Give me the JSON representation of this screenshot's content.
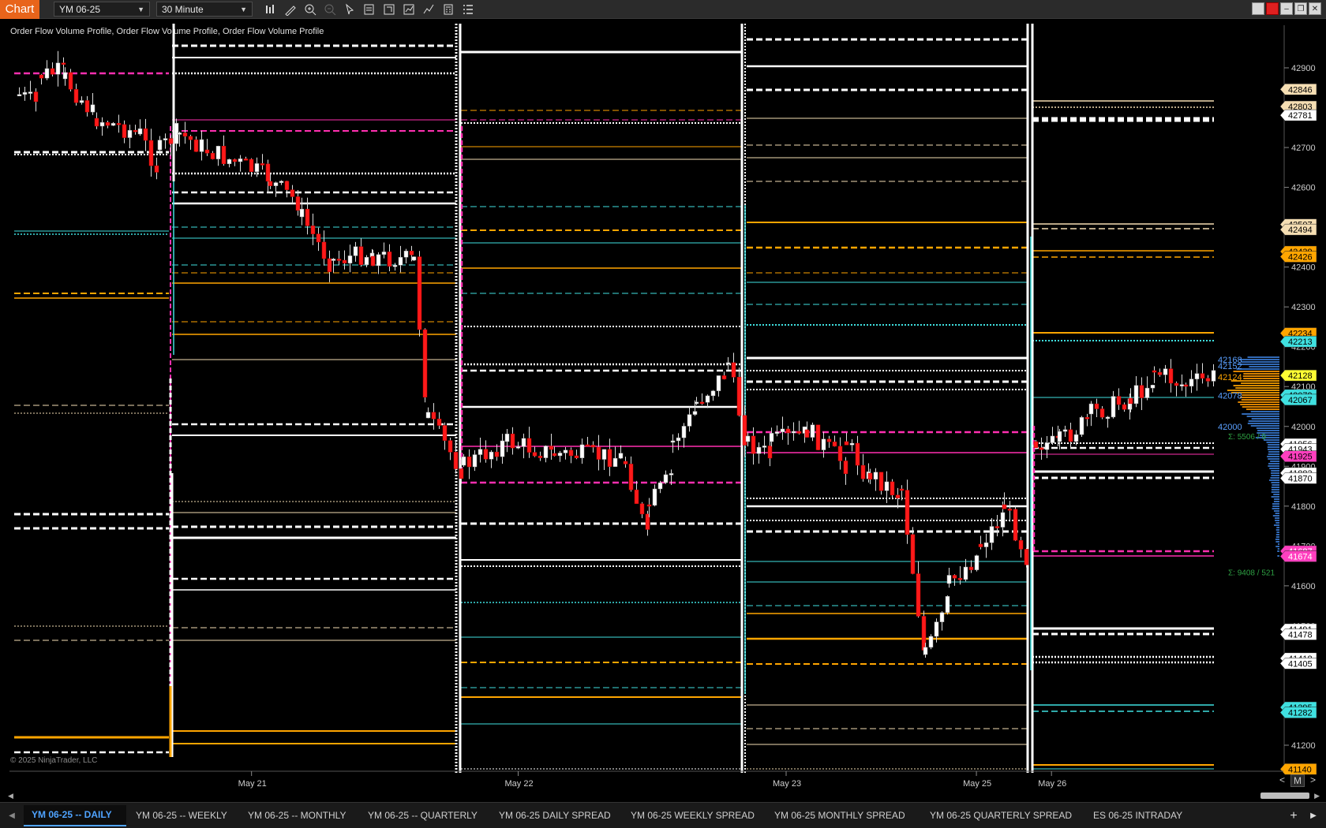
{
  "toolbar": {
    "badge": "Chart",
    "instrument": "YM 06-25",
    "interval": "30 Minute",
    "icons": [
      "bar-style-icon",
      "draw-pencil-icon",
      "zoom-in-icon",
      "zoom-out-icon",
      "pointer-icon",
      "data-box-icon",
      "properties-icon",
      "indicators-icon",
      "strategies-icon",
      "calculator-icon",
      "list-icon"
    ]
  },
  "chart": {
    "indicator_label": "Order Flow Volume Profile, Order Flow Volume Profile, Order Flow Volume Profile",
    "copyright": "© 2025 NinjaTrader, LLC",
    "price_axis": {
      "min": 41140,
      "max": 42940,
      "ticks": [
        42900,
        42800,
        42700,
        42600,
        42500,
        42400,
        42300,
        42200,
        42100,
        42000,
        41900,
        41800,
        41700,
        41600,
        41500,
        41400,
        41300,
        41200
      ]
    },
    "date_labels": [
      {
        "label": "May 21",
        "x_fraction": 0.187
      },
      {
        "label": "May 22",
        "x_fraction": 0.393
      },
      {
        "label": "May 23",
        "x_fraction": 0.6
      },
      {
        "label": "May 25",
        "x_fraction": 0.747
      },
      {
        "label": "May 26",
        "x_fraction": 0.805
      }
    ],
    "price_markers": [
      {
        "price": 42846,
        "label": "42846",
        "color": "#f5deb3",
        "text": "#000"
      },
      {
        "price": 42803,
        "label": "42803",
        "color": "#f5deb3",
        "text": "#000"
      },
      {
        "price": 42781,
        "label": "42781",
        "color": "#ffffff",
        "text": "#000"
      },
      {
        "price": 42507,
        "label": "42507",
        "color": "#f5deb3",
        "text": "#000"
      },
      {
        "price": 42494,
        "label": "42494",
        "color": "#f5deb3",
        "text": "#000"
      },
      {
        "price": 42439,
        "label": "42439",
        "color": "#ffa500",
        "text": "#000"
      },
      {
        "price": 42426,
        "label": "42426",
        "color": "#ffa500",
        "text": "#000"
      },
      {
        "price": 42234,
        "label": "42234",
        "color": "#ffa500",
        "text": "#000"
      },
      {
        "price": 42213,
        "label": "42213",
        "color": "#3fe0e0",
        "text": "#000"
      },
      {
        "price": 42128,
        "label": "42128",
        "color": "#ffff33",
        "text": "#000"
      },
      {
        "price": 42079,
        "label": "42079",
        "color": "#3fe0e0",
        "text": "#000"
      },
      {
        "price": 42067,
        "label": "42067",
        "color": "#3fe0e0",
        "text": "#000"
      },
      {
        "price": 41956,
        "label": "41956",
        "color": "#ffffff",
        "text": "#000"
      },
      {
        "price": 41943,
        "label": "41943",
        "color": "#ffffff",
        "text": "#000"
      },
      {
        "price": 41925,
        "label": "41925",
        "color": "#ff3fbf",
        "text": "#000"
      },
      {
        "price": 41883,
        "label": "41883",
        "color": "#ffffff",
        "text": "#000"
      },
      {
        "price": 41870,
        "label": "41870",
        "color": "#ffffff",
        "text": "#000"
      },
      {
        "price": 41687,
        "label": "41687",
        "color": "#ff3fbf",
        "text": "#fff"
      },
      {
        "price": 41674,
        "label": "41674",
        "color": "#ff3fbf",
        "text": "#fff"
      },
      {
        "price": 41491,
        "label": "41491",
        "color": "#ffffff",
        "text": "#000"
      },
      {
        "price": 41478,
        "label": "41478",
        "color": "#ffffff",
        "text": "#000"
      },
      {
        "price": 41418,
        "label": "41418",
        "color": "#ffffff",
        "text": "#000"
      },
      {
        "price": 41405,
        "label": "41405",
        "color": "#ffffff",
        "text": "#000"
      },
      {
        "price": 41295,
        "label": "41295",
        "color": "#3fe0e0",
        "text": "#000"
      },
      {
        "price": 41282,
        "label": "41282",
        "color": "#3fe0e0",
        "text": "#000"
      },
      {
        "price": 41140,
        "label": "41140",
        "color": "#ffa500",
        "text": "#000"
      }
    ],
    "profile_labels": [
      {
        "price": 42168,
        "label": "42168",
        "color": "#5aa0ff"
      },
      {
        "price": 42152,
        "label": "42152",
        "color": "#5aa0ff"
      },
      {
        "price": 42124,
        "label": "42124",
        "color": "#ffa500"
      },
      {
        "price": 42078,
        "label": "42078",
        "color": "#5aa0ff"
      },
      {
        "price": 42000,
        "label": "42000",
        "color": "#5aa0ff"
      }
    ],
    "sigma_labels": [
      {
        "price": 41976,
        "label": "Σ: 5506 / 9"
      },
      {
        "price": 41634,
        "label": "Σ: 9408 / 521"
      }
    ]
  },
  "zoom": {
    "left": "<",
    "mode": "M",
    "right": ">"
  },
  "tabs": [
    {
      "label": "YM 06-25 -- DAILY",
      "active": true
    },
    {
      "label": "YM 06-25 -- WEEKLY",
      "active": false
    },
    {
      "label": "YM 06-25 -- MONTHLY",
      "active": false
    },
    {
      "label": "YM 06-25 -- QUARTERLY",
      "active": false
    },
    {
      "label": "YM 06-25 DAILY SPREAD",
      "active": false
    },
    {
      "label": "YM 06-25 WEEKLY SPREAD",
      "active": false
    },
    {
      "label": "YM 06-25 MONTHLY SPREAD",
      "active": false
    },
    {
      "label": "YM 06-25 QUARTERLY SPREAD",
      "active": false
    },
    {
      "label": "ES 06-25 INTRADAY",
      "active": false
    }
  ],
  "tab_add": "+",
  "colors": {
    "white": "#ffffff",
    "wheat": "#f5deb3",
    "orange": "#ffa500",
    "cyan": "#3fe0e0",
    "magenta": "#ff2fb0",
    "up_candle": "#ffffff",
    "down_candle": "#ff1a1a",
    "accent_tab": "#4fa3ff",
    "badge": "#e8641b"
  }
}
